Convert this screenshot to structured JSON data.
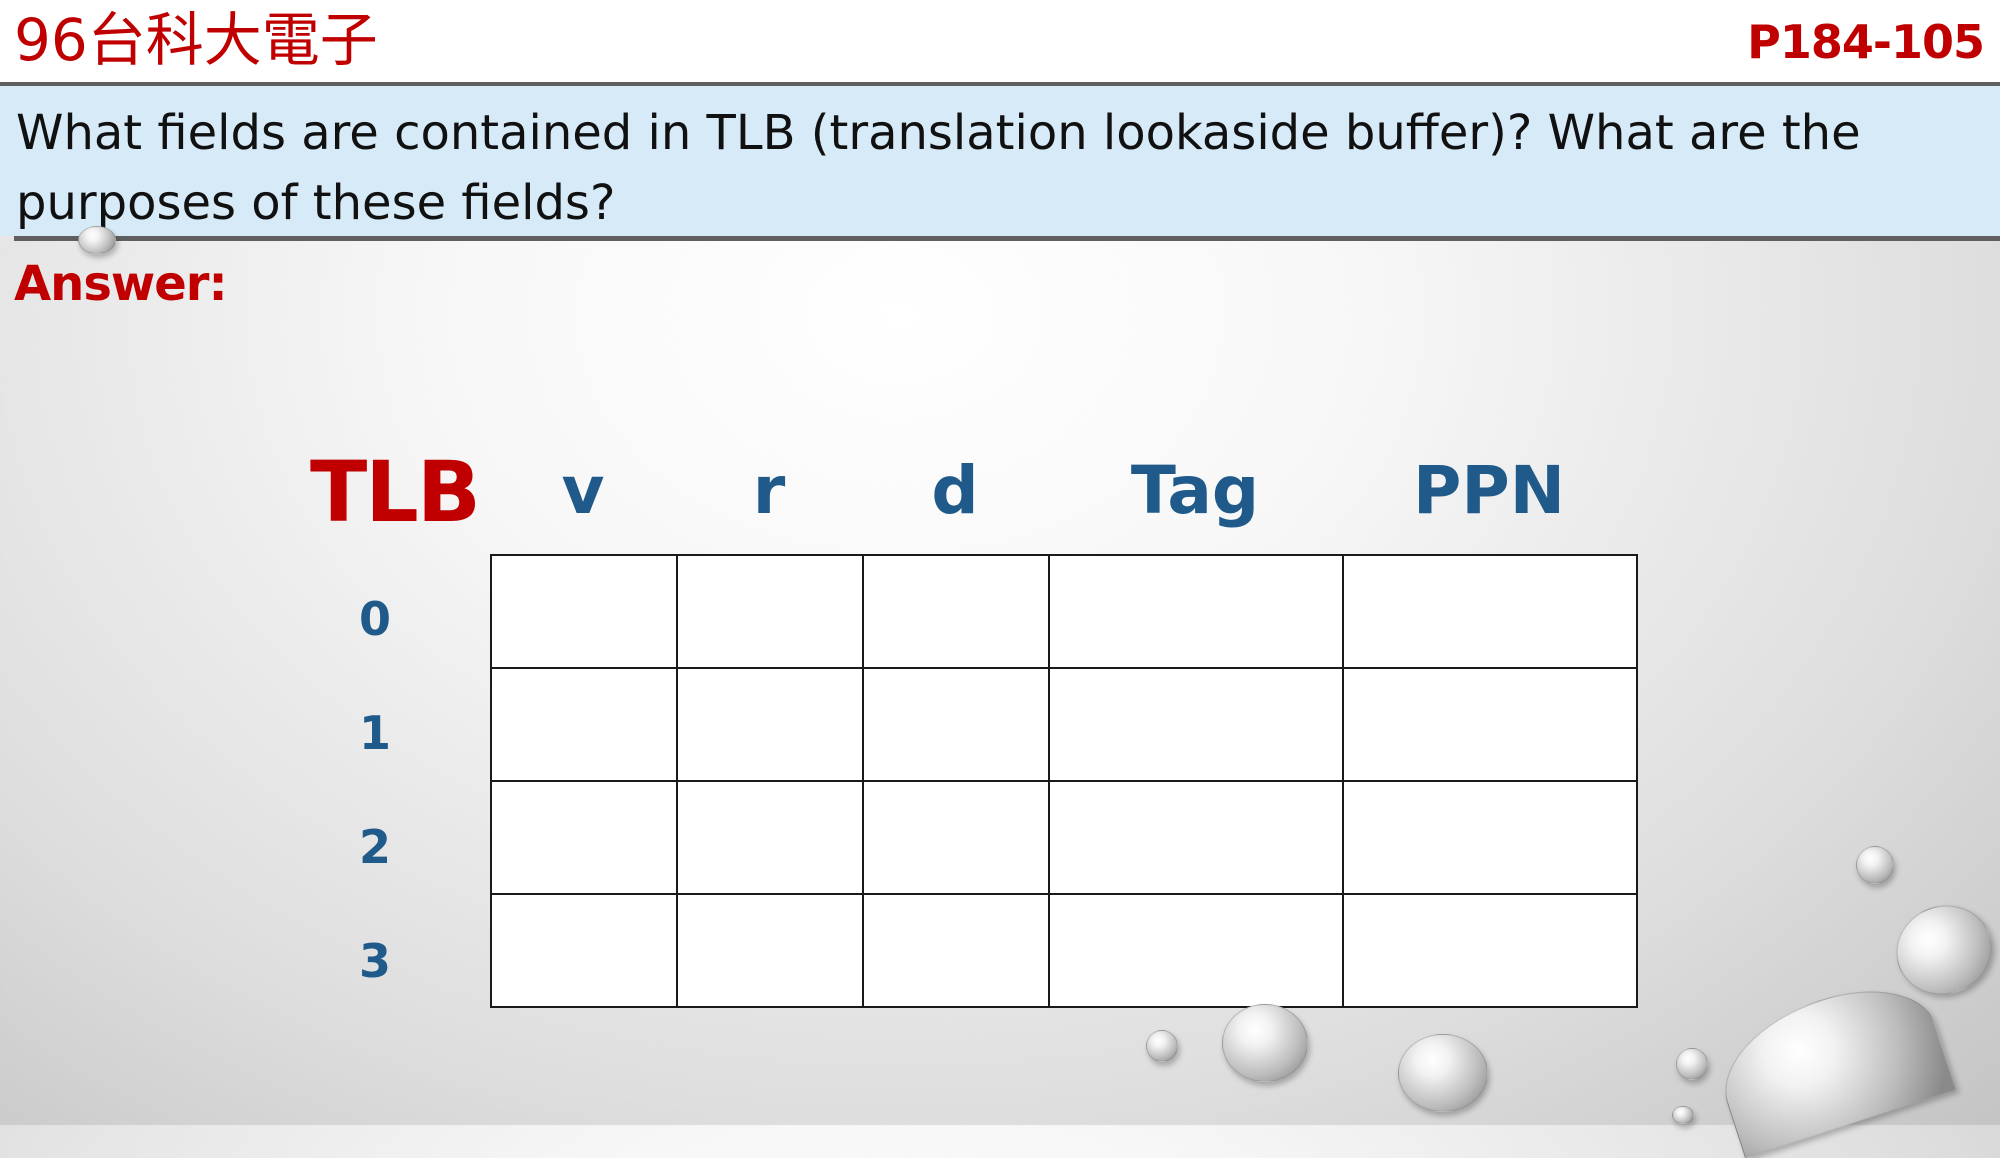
{
  "header": {
    "course_title": "96台科大電子",
    "page_ref": "P184-105"
  },
  "question": {
    "text": "What fields are contained in TLB (translation lookaside buffer)? What are the purposes of these fields?"
  },
  "answer": {
    "label": "Answer:"
  },
  "tlb_diagram": {
    "title": "TLB",
    "columns": [
      "v",
      "r",
      "d",
      "Tag",
      "PPN"
    ],
    "rows": [
      "0",
      "1",
      "2",
      "3"
    ]
  }
}
